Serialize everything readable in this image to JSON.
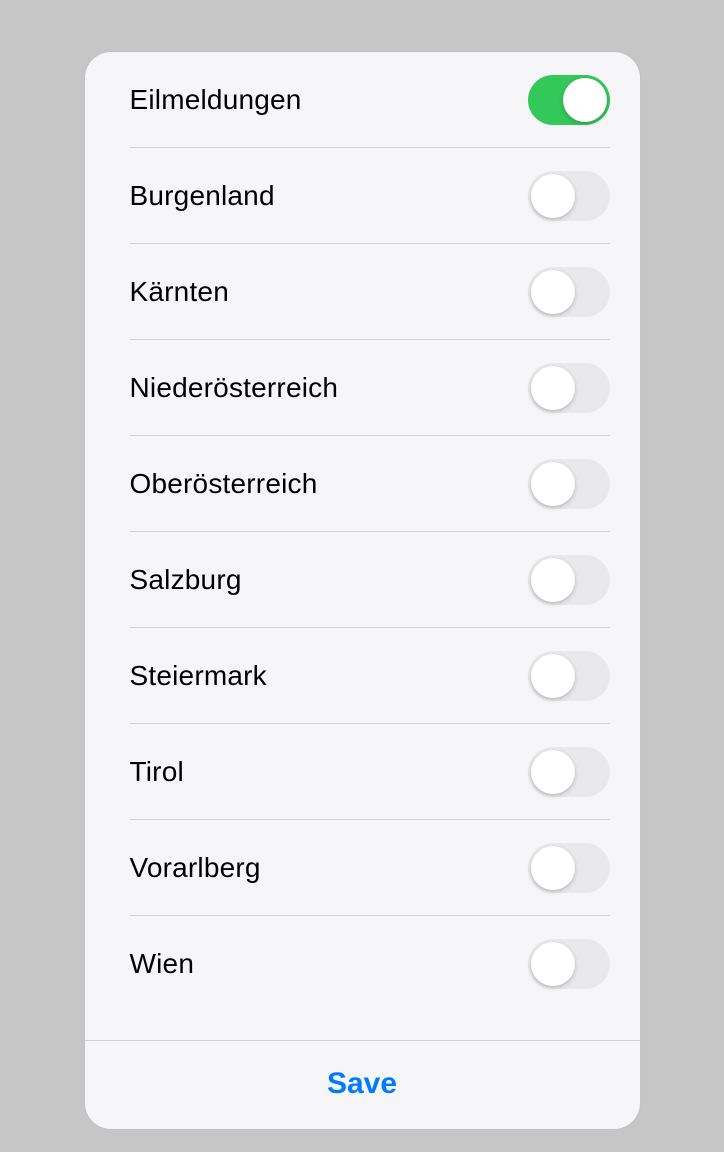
{
  "settings": {
    "items": [
      {
        "label": "Eilmeldungen",
        "on": true
      },
      {
        "label": "Burgenland",
        "on": false
      },
      {
        "label": "Kärnten",
        "on": false
      },
      {
        "label": "Niederösterreich",
        "on": false
      },
      {
        "label": "Oberösterreich",
        "on": false
      },
      {
        "label": "Salzburg",
        "on": false
      },
      {
        "label": "Steiermark",
        "on": false
      },
      {
        "label": "Tirol",
        "on": false
      },
      {
        "label": "Vorarlberg",
        "on": false
      },
      {
        "label": "Wien",
        "on": false
      }
    ]
  },
  "footer": {
    "save_label": "Save"
  },
  "colors": {
    "toggle_on": "#34c759",
    "toggle_off": "#e9e9eb",
    "accent": "#007aff"
  }
}
